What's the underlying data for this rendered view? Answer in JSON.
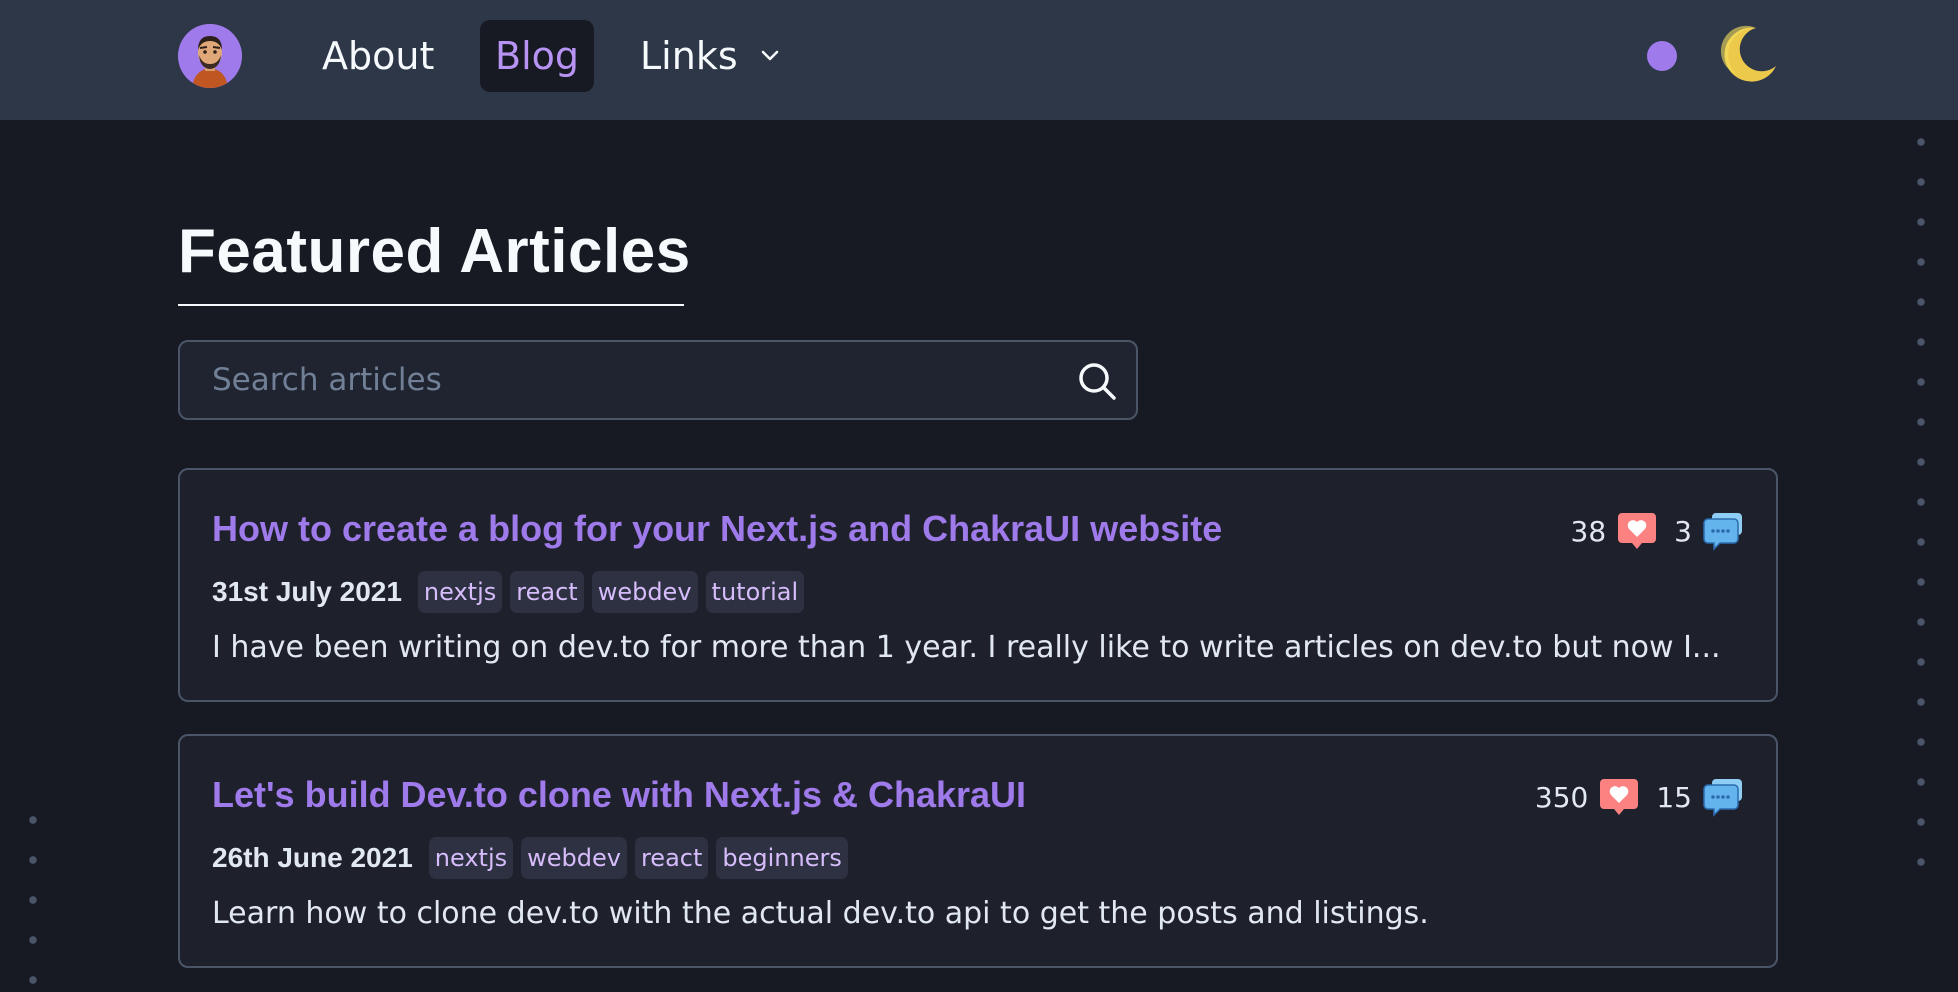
{
  "colors": {
    "bg": "#171923",
    "header": "#2d3748",
    "accent": "#9f7aea",
    "like": "#f56565",
    "comment": "#63b3ed"
  },
  "nav": {
    "avatar_icon": "memoji-avatar",
    "about_label": "About",
    "blog_label": "Blog",
    "links_label": "Links",
    "links_icon": "chevron-down-icon",
    "accent_picker_icon": "color-dot",
    "theme_icon": "moon-icon"
  },
  "main": {
    "title": "Featured Articles",
    "search": {
      "placeholder": "Search articles",
      "value": "",
      "icon": "search-icon"
    },
    "articles": [
      {
        "title": "How to create a blog for your Next.js and ChakraUI website",
        "likes": "38",
        "comments": "3",
        "date": "31st July 2021",
        "tags": [
          "nextjs",
          "react",
          "webdev",
          "tutorial"
        ],
        "description": "I have been writing on dev.to for more than 1 year. I really like to write articles on dev.to but now I..."
      },
      {
        "title": "Let's build Dev.to clone with Next.js & ChakraUI",
        "likes": "350",
        "comments": "15",
        "date": "26th June 2021",
        "tags": [
          "nextjs",
          "webdev",
          "react",
          "beginners"
        ],
        "description": "Learn how to clone dev.to with the actual dev.to api to get the posts and listings."
      }
    ]
  }
}
